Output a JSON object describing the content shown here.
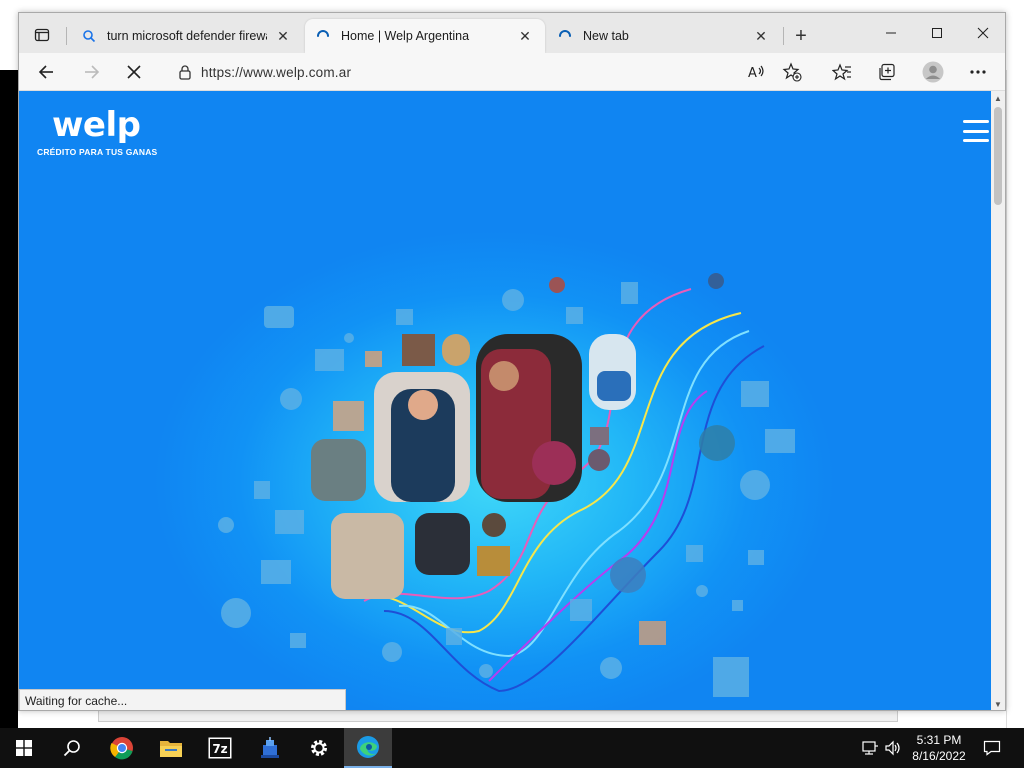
{
  "browser": {
    "tabs": [
      {
        "title": "turn microsoft defender firewall",
        "icon": "search-icon",
        "active": false
      },
      {
        "title": "Home | Welp Argentina",
        "icon": "loading-icon",
        "active": true
      },
      {
        "title": "New tab",
        "icon": "loading-icon",
        "active": false
      }
    ],
    "url": "https://www.welp.com.ar",
    "status_text": "Waiting for cache..."
  },
  "page": {
    "logo_text": "welp",
    "tagline": "CRÉDITO PARA TUS GANAS"
  },
  "taskbar": {
    "apps": [
      "start-icon",
      "search-icon",
      "chrome-icon",
      "file-explorer-icon",
      "7zip-icon",
      "network-app-icon",
      "settings-icon",
      "edge-icon"
    ],
    "seven_zip_label": "7z",
    "clock_time": "5:31 PM",
    "clock_date": "8/16/2022"
  },
  "colors": {
    "page_background": "#1187f3",
    "taskbar": "#101010",
    "accent": "#0078d4"
  }
}
